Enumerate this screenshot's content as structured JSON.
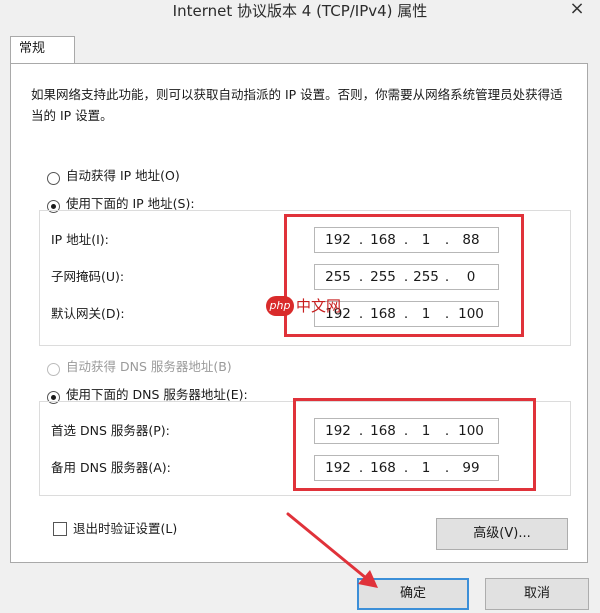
{
  "window": {
    "title": "Internet 协议版本 4 (TCP/IPv4) 属性",
    "close_glyph": "×"
  },
  "tabs": [
    {
      "label": "常规"
    }
  ],
  "description": "如果网络支持此功能，则可以获取自动指派的 IP 设置。否则，你需要从网络系统管理员处获得适当的 IP 设置。",
  "ip_section": {
    "auto_label": "自动获得 IP 地址(O)",
    "manual_label": "使用下面的 IP 地址(S):",
    "mode": "manual",
    "fields": [
      {
        "label": "IP 地址(I):",
        "octets": [
          "192",
          "168",
          "1",
          "88"
        ]
      },
      {
        "label": "子网掩码(U):",
        "octets": [
          "255",
          "255",
          "255",
          "0"
        ]
      },
      {
        "label": "默认网关(D):",
        "octets": [
          "192",
          "168",
          "1",
          "100"
        ]
      }
    ]
  },
  "dns_section": {
    "auto_label": "自动获得 DNS 服务器地址(B)",
    "manual_label": "使用下面的 DNS 服务器地址(E):",
    "mode": "manual",
    "auto_disabled": true,
    "fields": [
      {
        "label": "首选 DNS 服务器(P):",
        "octets": [
          "192",
          "168",
          "1",
          "100"
        ]
      },
      {
        "label": "备用 DNS 服务器(A):",
        "octets": [
          "192",
          "168",
          "1",
          "99"
        ]
      }
    ]
  },
  "validate_on_exit_label": "退出时验证设置(L)",
  "validate_on_exit_checked": false,
  "buttons": {
    "advanced": "高级(V)...",
    "ok": "确定",
    "cancel": "取消"
  },
  "watermark": {
    "badge": "php",
    "text": "中文网"
  },
  "colors": {
    "highlight_red": "#e0323a",
    "ok_border": "#3c8fd8"
  }
}
